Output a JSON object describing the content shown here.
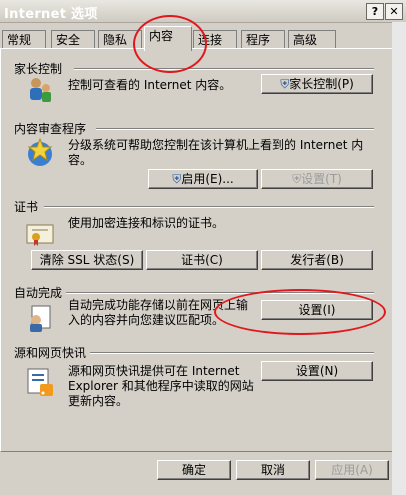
{
  "window": {
    "title": "Internet 选项"
  },
  "tabs": [
    {
      "label": "常规"
    },
    {
      "label": "安全"
    },
    {
      "label": "隐私"
    },
    {
      "label": "内容"
    },
    {
      "label": "连接"
    },
    {
      "label": "程序"
    },
    {
      "label": "高级"
    }
  ],
  "active_tab": "内容",
  "parental": {
    "title": "家长控制",
    "desc": "控制可查看的 Internet 内容。",
    "button": "家长控制(P)"
  },
  "advisor": {
    "title": "内容审查程序",
    "desc": "分级系统可帮助您控制在该计算机上看到的 Internet 内容。",
    "enable": "启用(E)...",
    "settings": "设置(T)"
  },
  "certs": {
    "title": "证书",
    "desc": "使用加密连接和标识的证书。",
    "clear_ssl": "清除 SSL 状态(S)",
    "certificates": "证书(C)",
    "publishers": "发行者(B)"
  },
  "autocomplete": {
    "title": "自动完成",
    "desc": "自动完成功能存储以前在网页上输入的内容并向您建议匹配项。",
    "settings": "设置(I)"
  },
  "feeds": {
    "title": "源和网页快讯",
    "desc": "源和网页快讯提供可在 Internet Explorer 和其他程序中读取的网站更新内容。",
    "settings": "设置(N)"
  },
  "footer": {
    "ok": "确定",
    "cancel": "取消",
    "apply": "应用(A)"
  },
  "colors": {
    "annotation": "#e0171c",
    "face": "#d4d0c8"
  }
}
